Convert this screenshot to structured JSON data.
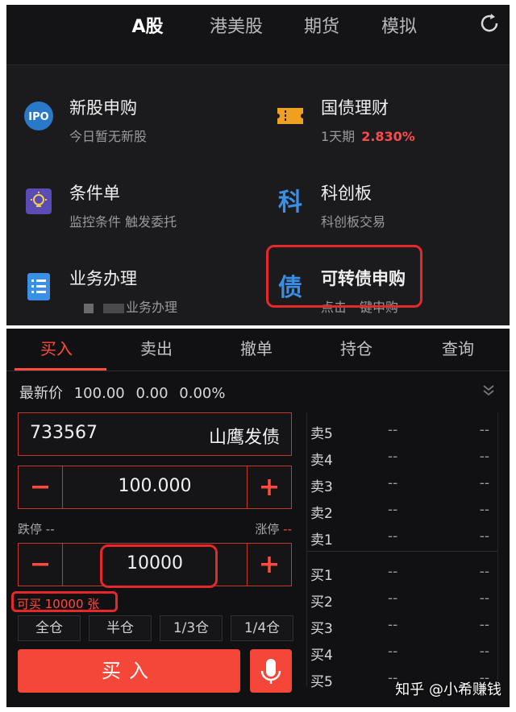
{
  "colors": {
    "accent": "#f4473a",
    "highlight": "#e5282a",
    "rate": "#ff4a4a"
  },
  "topnav": {
    "tabs": [
      {
        "label": "A股",
        "active": true
      },
      {
        "label": "港美股",
        "active": false
      },
      {
        "label": "期货",
        "active": false
      },
      {
        "label": "模拟",
        "active": false
      }
    ],
    "refresh_icon": "refresh-icon"
  },
  "services": {
    "ipo": {
      "title": "新股申购",
      "subtitle": "今日暂无新股",
      "icon": "ipo-icon",
      "icon_text": "IPO"
    },
    "bond": {
      "title": "国债理财",
      "subtitle": "1天期",
      "rate": "2.830%",
      "icon": "ticket-icon"
    },
    "condition": {
      "title": "条件单",
      "subtitle": "监控条件 触发委托",
      "icon": "bulb-icon"
    },
    "star": {
      "title": "科创板",
      "subtitle": "科创板交易",
      "icon": "ke-icon",
      "icon_text": "科"
    },
    "business": {
      "title": "业务办理",
      "subtitle": "业务办理",
      "icon": "list-icon"
    },
    "convertible": {
      "title": "可转债申购",
      "subtitle": "点击一键申购",
      "icon": "zhai-icon",
      "icon_text": "债"
    }
  },
  "trade": {
    "tabs": [
      {
        "label": "买入",
        "active": true
      },
      {
        "label": "卖出",
        "active": false
      },
      {
        "label": "撤单",
        "active": false
      },
      {
        "label": "持仓",
        "active": false
      },
      {
        "label": "查询",
        "active": false
      }
    ],
    "latest_label": "最新价",
    "latest_price": "100.00",
    "change": "0.00",
    "change_pct": "0.00%",
    "code": "733567",
    "name": "山鹰发债",
    "price": "100.000",
    "limit_down_label": "跌停",
    "limit_down": "--",
    "limit_up_label": "涨停",
    "limit_up": "--",
    "quantity": "10000",
    "available": "可买 10000 张",
    "ratios": [
      "全仓",
      "半仓",
      "1/3仓",
      "1/4仓"
    ],
    "buy_button": "买入",
    "minus": "−",
    "plus": "+"
  },
  "orderbook": {
    "asks": [
      {
        "label": "卖5",
        "price": "--",
        "vol": "--"
      },
      {
        "label": "卖4",
        "price": "--",
        "vol": "--"
      },
      {
        "label": "卖3",
        "price": "--",
        "vol": "--"
      },
      {
        "label": "卖2",
        "price": "--",
        "vol": "--"
      },
      {
        "label": "卖1",
        "price": "--",
        "vol": "--"
      }
    ],
    "bids": [
      {
        "label": "买1",
        "price": "--",
        "vol": "--"
      },
      {
        "label": "买2",
        "price": "--",
        "vol": "--"
      },
      {
        "label": "买3",
        "price": "--",
        "vol": "--"
      },
      {
        "label": "买4",
        "price": "--",
        "vol": "--"
      },
      {
        "label": "买5",
        "price": "--",
        "vol": "--"
      }
    ]
  },
  "watermark": "知乎 @小希赚钱"
}
